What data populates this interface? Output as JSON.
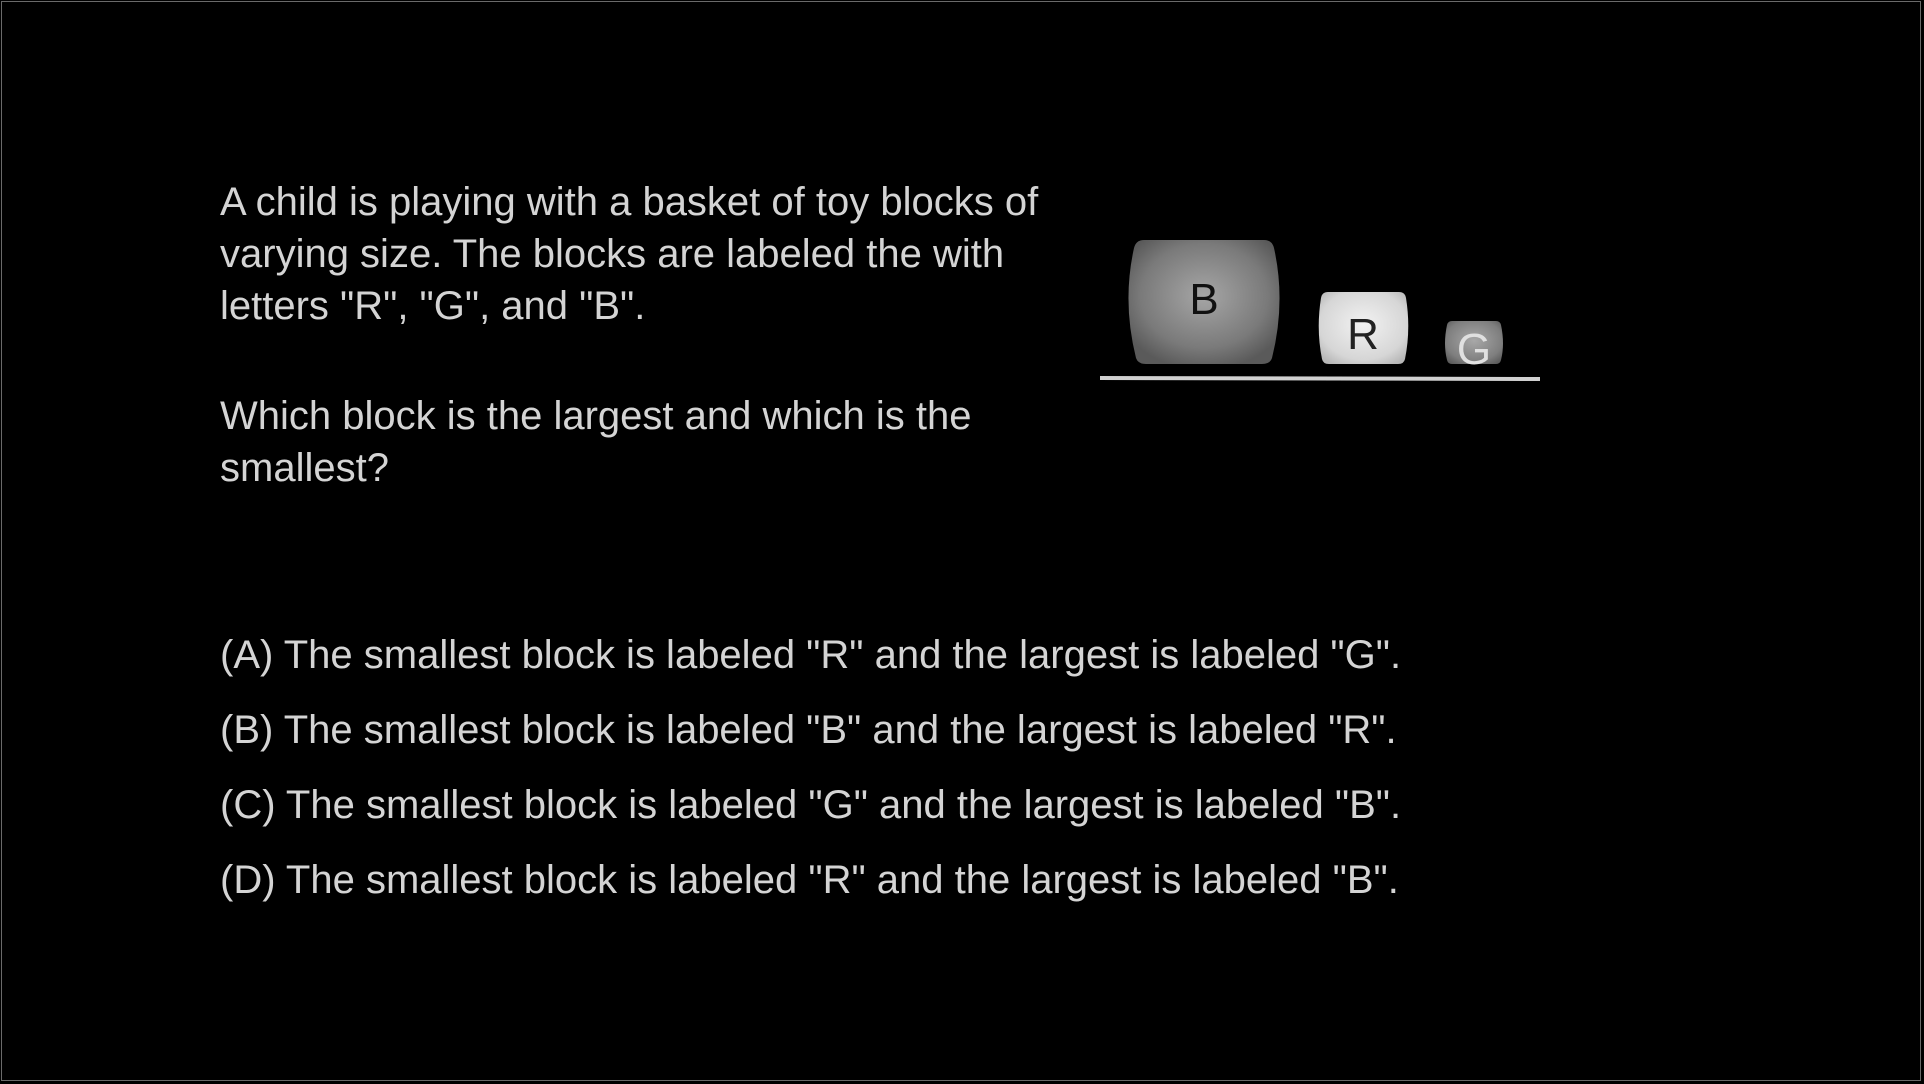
{
  "question": {
    "intro": "A child is playing with a basket of toy blocks of varying size. The blocks are labeled the with letters \"R\", \"G\", and \"B\".",
    "prompt": "Which block is the largest and which is the smallest?"
  },
  "blocks": [
    {
      "label": "B",
      "fill": "#808080",
      "relative_size": "large"
    },
    {
      "label": "R",
      "fill": "#d9d9d9",
      "relative_size": "medium"
    },
    {
      "label": "G",
      "fill": "#8a8a8a",
      "relative_size": "small"
    }
  ],
  "options": [
    {
      "text": "(A) The smallest block is labeled \"R\" and the largest is labeled \"G\"."
    },
    {
      "text": "(B) The smallest block is labeled \"B\" and the largest is labeled \"R\"."
    },
    {
      "text": "(C) The smallest block is labeled \"G\" and the largest is labeled \"B\"."
    },
    {
      "text": "(D) The smallest block is labeled \"R\" and the largest is labeled \"B\"."
    }
  ],
  "colors": {
    "background": "#000000",
    "text": "#d4d4d4",
    "ground_line": "#d0d0d0"
  }
}
